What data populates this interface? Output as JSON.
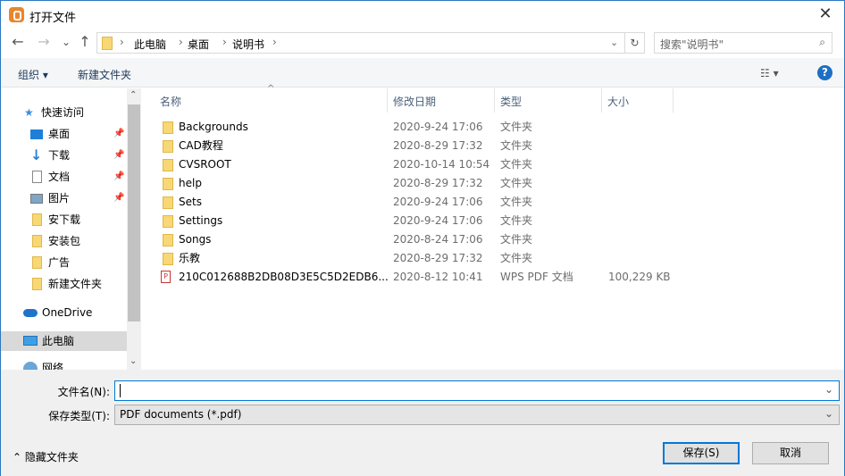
{
  "window": {
    "title": "打开文件",
    "close": "✕"
  },
  "nav": {
    "back": "←",
    "forward": "→",
    "recent": "⌄",
    "up": "↑",
    "refresh": "↻",
    "dropdown": "⌄"
  },
  "address": {
    "crumbs": [
      "此电脑",
      "桌面",
      "说明书"
    ],
    "separator": "›"
  },
  "search": {
    "placeholder": "搜索\"说明书\"",
    "icon": "⌕"
  },
  "toolbar": {
    "organize": "组织 ▾",
    "new_folder": "新建文件夹",
    "view": "☷ ▾",
    "help": "?"
  },
  "sidebar": {
    "items": [
      {
        "label": "快速访问",
        "icon": "star-icon"
      },
      {
        "label": "桌面",
        "icon": "desktop-icon",
        "pinned": true
      },
      {
        "label": "下载",
        "icon": "download-icon",
        "pinned": true
      },
      {
        "label": "文档",
        "icon": "document-icon",
        "pinned": true
      },
      {
        "label": "图片",
        "icon": "pictures-icon",
        "pinned": true
      },
      {
        "label": "安下载",
        "icon": "folder-icon"
      },
      {
        "label": "安装包",
        "icon": "folder-icon"
      },
      {
        "label": "广告",
        "icon": "folder-icon"
      },
      {
        "label": "新建文件夹",
        "icon": "folder-icon"
      },
      {
        "label": "OneDrive",
        "icon": "cloud-icon"
      },
      {
        "label": "此电脑",
        "icon": "computer-icon",
        "selected": true
      },
      {
        "label": "网络",
        "icon": "network-icon"
      }
    ]
  },
  "columns": [
    "名称",
    "修改日期",
    "类型",
    "大小"
  ],
  "files": [
    {
      "name": "Backgrounds",
      "date": "2020-9-24 17:06",
      "type": "文件夹",
      "size": ""
    },
    {
      "name": "CAD教程",
      "date": "2020-8-29 17:32",
      "type": "文件夹",
      "size": ""
    },
    {
      "name": "CVSROOT",
      "date": "2020-10-14 10:54",
      "type": "文件夹",
      "size": ""
    },
    {
      "name": "help",
      "date": "2020-8-29 17:32",
      "type": "文件夹",
      "size": ""
    },
    {
      "name": "Sets",
      "date": "2020-9-24 17:06",
      "type": "文件夹",
      "size": ""
    },
    {
      "name": "Settings",
      "date": "2020-9-24 17:06",
      "type": "文件夹",
      "size": ""
    },
    {
      "name": "Songs",
      "date": "2020-8-24 17:06",
      "type": "文件夹",
      "size": ""
    },
    {
      "name": "乐教",
      "date": "2020-8-29 17:32",
      "type": "文件夹",
      "size": ""
    },
    {
      "name": "210C012688B2DB08D3E5C5D2EDB6...",
      "date": "2020-8-12 10:41",
      "type": "WPS PDF 文档",
      "size": "100,229 KB"
    }
  ],
  "form": {
    "filename_label": "文件名(N):",
    "filename_value": "",
    "filetype_label": "保存类型(T):",
    "filetype_value": "PDF documents (*.pdf)"
  },
  "footer": {
    "hide_folders": "⌃ 隐藏文件夹",
    "save": "保存(S)",
    "cancel": "取消"
  }
}
